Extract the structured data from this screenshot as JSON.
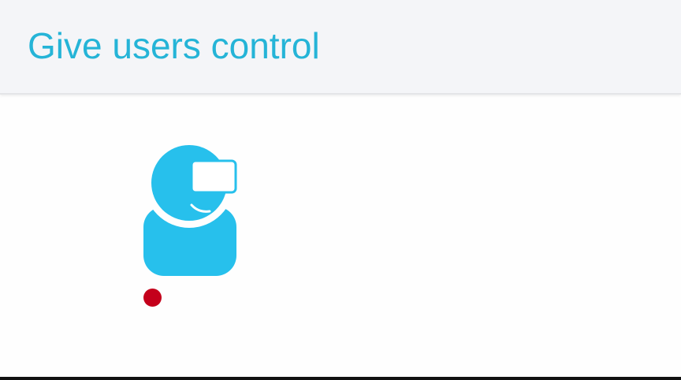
{
  "header": {
    "title": "Give users control"
  },
  "illustration": {
    "icon": "user-with-screen-icon",
    "figure_color": "#27c0ec",
    "record_indicator_color": "#c4001b"
  },
  "colors": {
    "title": "#25b4d7",
    "header_background": "#f4f5f8",
    "page_background": "#fefefe"
  }
}
